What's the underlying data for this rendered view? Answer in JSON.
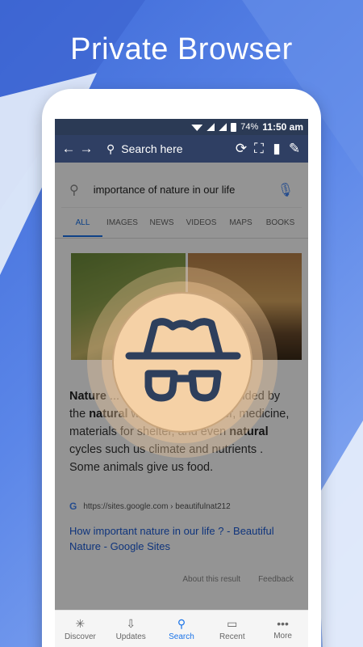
{
  "headline": "Private Browser",
  "status": {
    "battery": "74%",
    "time": "11:50 am"
  },
  "toolbar": {
    "search_placeholder": "Search here"
  },
  "google": {
    "query": "importance of nature in our life",
    "tabs": [
      "ALL",
      "IMAGES",
      "NEWS",
      "VIDEOS",
      "MAPS",
      "BOOKS"
    ],
    "snippet_parts": [
      {
        "b": "Nature",
        "t": " ... have needed to ... provided by the "
      },
      {
        "b": "natural",
        "t": " world ... food, water, medicine, materials for shelter, and even "
      },
      {
        "b": "natural",
        "t": " cycles such us climate and nutrients . Some animals give us food."
      }
    ],
    "source": "https://sites.google.com › beautifulnat212",
    "link_title": "How important nature in our life ? - Beautiful Nature - Google Sites",
    "about": "About this result",
    "feedback": "Feedback"
  },
  "nav": [
    {
      "label": "Discover",
      "icon": "discover-icon"
    },
    {
      "label": "Updates",
      "icon": "updates-icon"
    },
    {
      "label": "Search",
      "icon": "search-icon"
    },
    {
      "label": "Recent",
      "icon": "recent-icon"
    },
    {
      "label": "More",
      "icon": "more-icon"
    }
  ],
  "colors": {
    "accent": "#1a73e8",
    "toolbar": "#2f3f63",
    "badge": "#f5d1a6",
    "badge_ink": "#2e3f5c"
  }
}
